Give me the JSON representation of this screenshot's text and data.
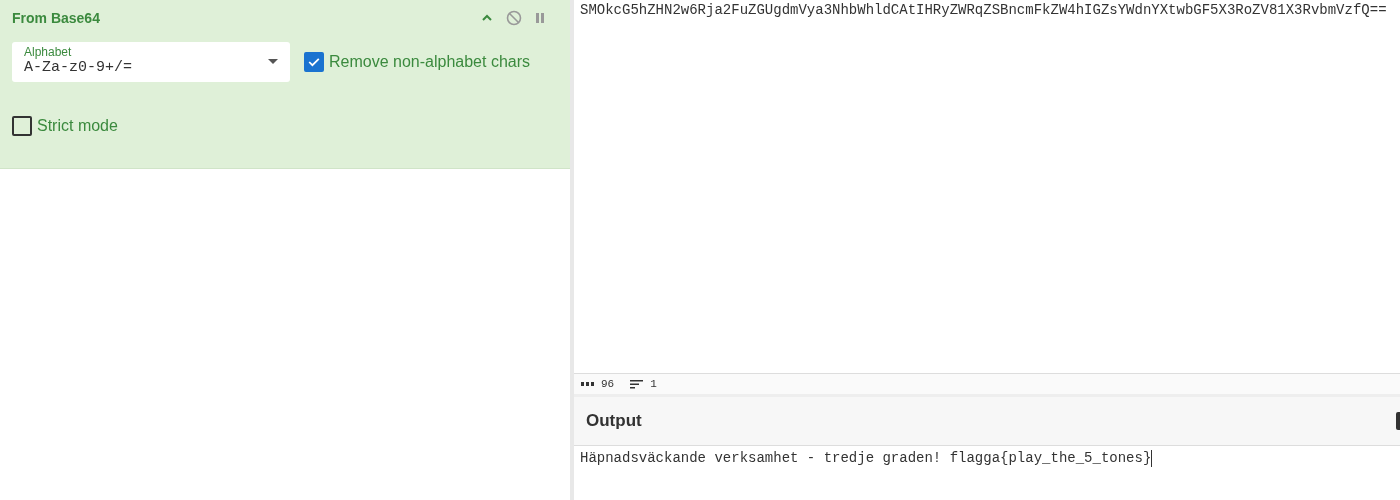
{
  "operation": {
    "title": "From Base64",
    "disabled": false,
    "paused": false,
    "options": [
      {
        "kind": "select",
        "label": "Alphabet",
        "value": "A-Za-z0-9+/="
      },
      {
        "kind": "checkbox",
        "label": "Remove non-alphabet chars",
        "checked": true
      },
      {
        "kind": "checkbox",
        "label": "Strict mode",
        "checked": false
      }
    ]
  },
  "input": {
    "text": "SMOkcG5hZHN2w6Rja2FuZGUgdmVya3NhbWhldCAtIHRyZWRqZSBncmFkZW4hIGZsYWdnYXtwbGF5X3RoZV81X3RvbmVzfQ==",
    "length": "96",
    "lines": "1"
  },
  "output": {
    "title": "Output",
    "text": "Häpnadsväckande verksamhet - tredje graden! flagga{play_the_5_tones}"
  }
}
